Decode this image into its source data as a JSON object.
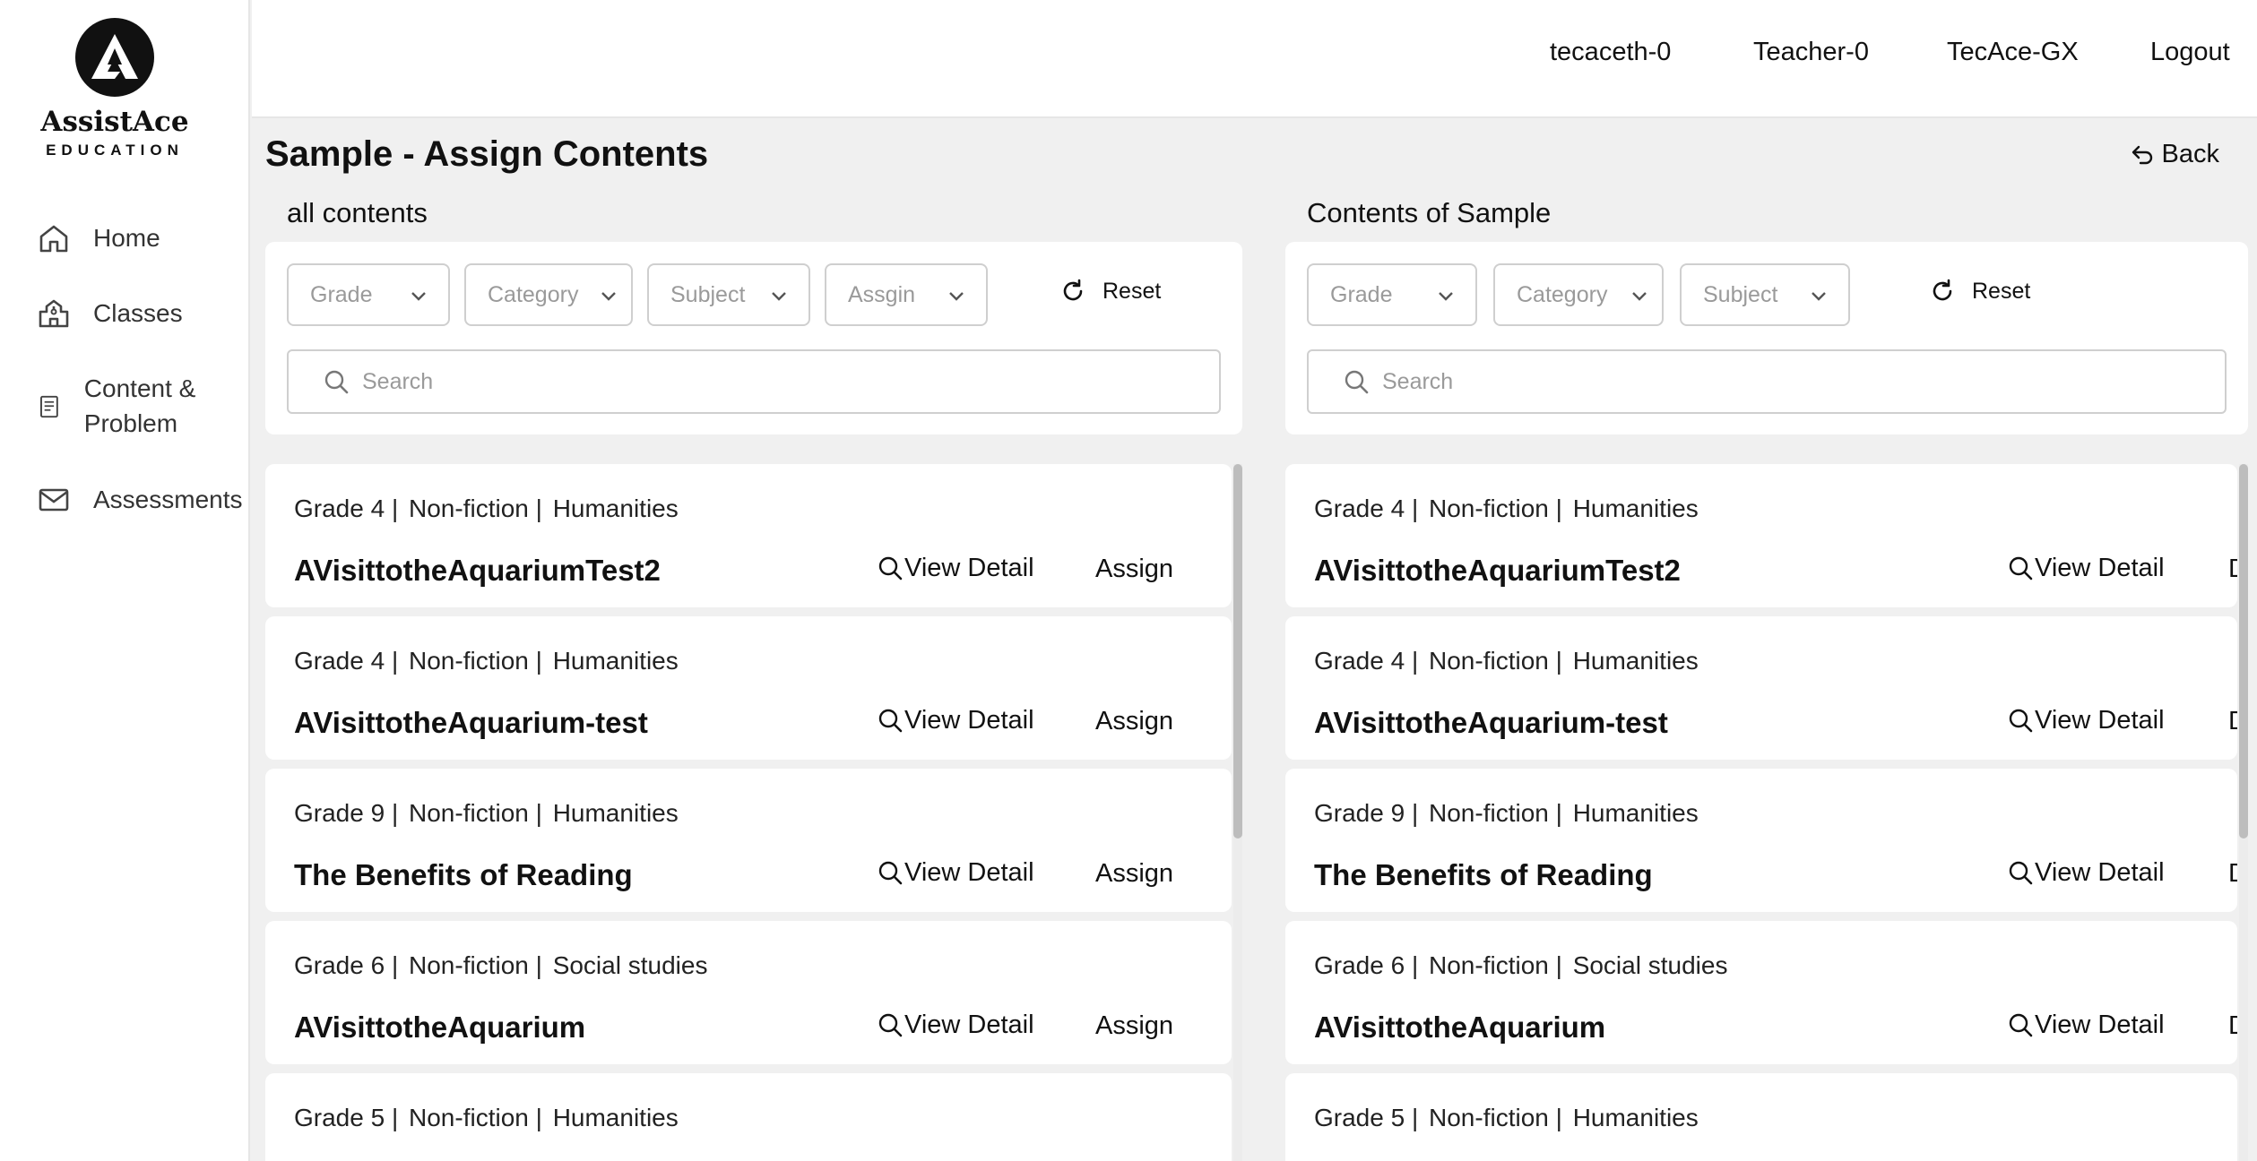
{
  "app": {
    "logo_name": "AssistAce",
    "logo_sub": "EDUCATION"
  },
  "sidebar": {
    "items": [
      {
        "label": "Home",
        "icon": "home-icon"
      },
      {
        "label": "Classes",
        "icon": "school-building-icon"
      },
      {
        "label": "Content & Problem",
        "icon": "document-icon"
      },
      {
        "label": "Assessments",
        "icon": "envelope-icon"
      }
    ]
  },
  "header": {
    "user_id": "tecaceth-0",
    "role": "Teacher-0",
    "org": "TecAce-GX",
    "logout": "Logout"
  },
  "page": {
    "title": "Sample - Assign Contents",
    "back": "Back"
  },
  "left_panel": {
    "title": "all contents",
    "filters": [
      "Grade",
      "Category",
      "Subject",
      "Assgin"
    ],
    "reset": "Reset",
    "search_placeholder": "Search",
    "action_label": "Assign",
    "view_label": "View Detail"
  },
  "right_panel": {
    "title": "Contents of Sample",
    "filters": [
      "Grade",
      "Category",
      "Subject"
    ],
    "reset": "Reset",
    "search_placeholder": "Search",
    "action_label": "Delete",
    "view_label": "View Detail"
  },
  "items": [
    {
      "grade": "Grade 4 |",
      "category": "Non-fiction |",
      "subject": "Humanities",
      "name": "AVisittotheAquariumTest2"
    },
    {
      "grade": "Grade 4 |",
      "category": "Non-fiction |",
      "subject": "Humanities",
      "name": "AVisittotheAquarium-test"
    },
    {
      "grade": "Grade 9 |",
      "category": "Non-fiction |",
      "subject": "Humanities",
      "name": "The Benefits of Reading"
    },
    {
      "grade": "Grade 6 |",
      "category": "Non-fiction |",
      "subject": "Social studies",
      "name": "AVisittotheAquarium"
    },
    {
      "grade": "Grade 5 |",
      "category": "Non-fiction |",
      "subject": "Humanities",
      "name": ""
    }
  ]
}
